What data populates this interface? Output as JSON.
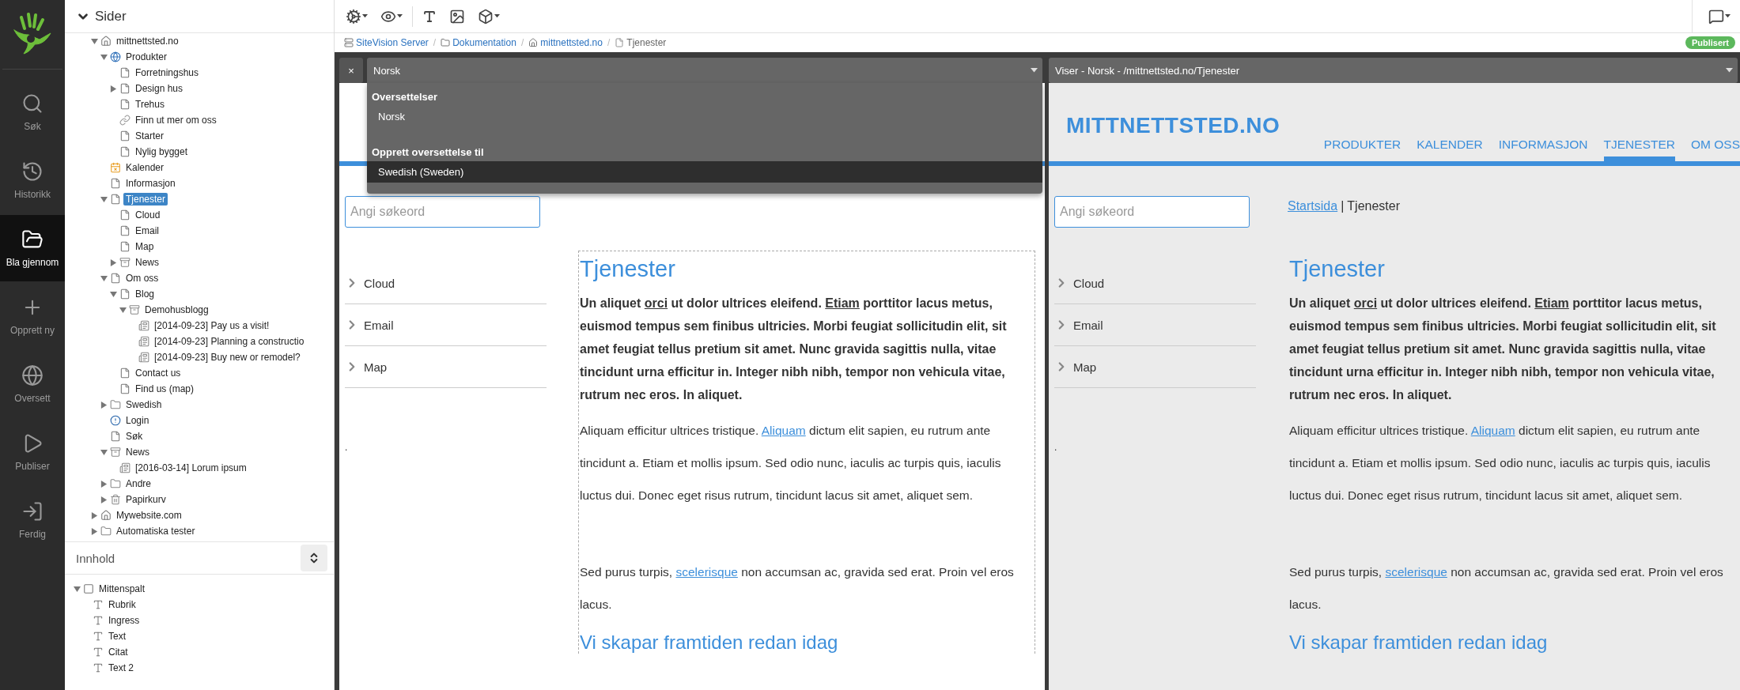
{
  "rail": {
    "items": [
      {
        "kind": "search",
        "label": "Søk",
        "selected": false
      },
      {
        "kind": "history",
        "label": "Historikk",
        "selected": false
      },
      {
        "kind": "browse",
        "label": "Bla gjennom",
        "selected": true
      },
      {
        "kind": "create",
        "label": "Opprett ny",
        "selected": false
      },
      {
        "kind": "translate",
        "label": "Oversett",
        "selected": false
      },
      {
        "kind": "publish",
        "label": "Publiser",
        "selected": false
      },
      {
        "kind": "done",
        "label": "Ferdig",
        "selected": false
      }
    ]
  },
  "pages_panel": {
    "title": "Sider",
    "expanded": true,
    "tree": [
      {
        "kind": "home",
        "label": "mittnettsted.no",
        "expanded": true,
        "selected": false,
        "children": [
          {
            "kind": "globe-page",
            "label": "Produkter",
            "expanded": true,
            "selected": false,
            "children": [
              {
                "kind": "page",
                "label": "Forretningshus",
                "selected": false
              },
              {
                "kind": "page",
                "label": "Design hus",
                "expanded": false,
                "selected": false
              },
              {
                "kind": "page",
                "label": "Trehus",
                "selected": false
              },
              {
                "kind": "link",
                "label": "Finn ut mer om oss",
                "selected": false
              },
              {
                "kind": "page",
                "label": "Starter",
                "selected": false
              },
              {
                "kind": "page",
                "label": "Nylig bygget",
                "selected": false
              }
            ]
          },
          {
            "kind": "calendar",
            "label": "Kalender",
            "selected": false
          },
          {
            "kind": "page",
            "label": "Informasjon",
            "selected": false
          },
          {
            "kind": "page",
            "label": "Tjenester",
            "expanded": true,
            "selected": true,
            "children": [
              {
                "kind": "page",
                "label": "Cloud",
                "selected": false
              },
              {
                "kind": "page",
                "label": "Email",
                "selected": false
              },
              {
                "kind": "page",
                "label": "Map",
                "selected": false
              },
              {
                "kind": "archive",
                "label": "News",
                "expanded": false,
                "selected": false
              }
            ]
          },
          {
            "kind": "page",
            "label": "Om oss",
            "expanded": true,
            "selected": false,
            "children": [
              {
                "kind": "page",
                "label": "Blog",
                "expanded": true,
                "selected": false,
                "children": [
                  {
                    "kind": "archive",
                    "label": "Demohusblogg",
                    "expanded": true,
                    "selected": false,
                    "children": [
                      {
                        "kind": "article",
                        "label": "[2014-09-23] Pay us a visit!",
                        "selected": false
                      },
                      {
                        "kind": "article",
                        "label": "[2014-09-23] Planning a constructio",
                        "selected": false
                      },
                      {
                        "kind": "article",
                        "label": "[2014-09-23] Buy new or remodel?",
                        "selected": false
                      }
                    ]
                  }
                ]
              },
              {
                "kind": "page",
                "label": "Contact us",
                "selected": false
              },
              {
                "kind": "page",
                "label": "Find us (map)",
                "selected": false
              }
            ]
          },
          {
            "kind": "folder",
            "label": "Swedish",
            "expanded": false,
            "selected": false
          },
          {
            "kind": "login",
            "label": "Login",
            "selected": false
          },
          {
            "kind": "page",
            "label": "Søk",
            "selected": false
          },
          {
            "kind": "archive",
            "label": "News",
            "expanded": true,
            "selected": false,
            "children": [
              {
                "kind": "article",
                "label": "[2016-03-14] Lorum ipsum",
                "selected": false
              }
            ]
          },
          {
            "kind": "folder",
            "label": "Andre",
            "expanded": false,
            "selected": false
          },
          {
            "kind": "trash",
            "label": "Papirkurv",
            "expanded": false,
            "selected": false
          }
        ]
      },
      {
        "kind": "home",
        "label": "Mywebsite.com",
        "expanded": false,
        "selected": false
      },
      {
        "kind": "folder",
        "label": "Automatiska tester",
        "expanded": false,
        "selected": false
      }
    ]
  },
  "content_panel": {
    "title": "Innhold",
    "tree": [
      {
        "kind": "region",
        "label": "Mittenspalt",
        "expanded": true,
        "selected": false,
        "children": [
          {
            "kind": "text",
            "label": "Rubrik",
            "selected": false
          },
          {
            "kind": "text",
            "label": "Ingress",
            "selected": false
          },
          {
            "kind": "text",
            "label": "Text",
            "selected": false
          },
          {
            "kind": "text",
            "label": "Citat",
            "selected": false
          },
          {
            "kind": "text",
            "label": "Text 2",
            "selected": false
          }
        ]
      }
    ]
  },
  "toolbar": {
    "tools": [
      {
        "kind": "settings",
        "menu": true
      },
      {
        "kind": "preview",
        "menu": true
      },
      {
        "kind": "font",
        "menu": false
      },
      {
        "kind": "image",
        "menu": false
      },
      {
        "kind": "module",
        "menu": true
      }
    ],
    "right_tools": [
      {
        "kind": "comment",
        "menu": true
      }
    ]
  },
  "breadcrumb": {
    "separator": "/",
    "items": [
      {
        "kind": "server",
        "label": "SiteVision Server",
        "current": false
      },
      {
        "kind": "folder",
        "label": "Dokumentation",
        "current": false
      },
      {
        "kind": "home",
        "label": "mittnettsted.no",
        "current": false
      },
      {
        "kind": "page",
        "label": "Tjenester",
        "current": true
      }
    ]
  },
  "status_badge": "Publisert",
  "left_pane": {
    "close_label": "×",
    "select": {
      "value": "Norsk",
      "open": true,
      "groups": [
        {
          "label": "Oversettelser",
          "options": [
            {
              "label": "Norsk",
              "selected": false
            }
          ]
        },
        {
          "label": "Opprett oversettelse til",
          "options": [
            {
              "label": "Swedish (Sweden)",
              "selected": true
            }
          ]
        }
      ]
    },
    "preview": {
      "edit_mode": true,
      "search_placeholder": "Angi søkeord",
      "subnav": [
        "Cloud",
        "Email",
        "Map"
      ],
      "sidebar_mark": ".",
      "article": {
        "heading": "Tjenester",
        "ingress": [
          {
            "text": "Un aliquet ",
            "link": false
          },
          {
            "text": "orci",
            "link": true
          },
          {
            "text": " ut dolor ultrices eleifend. ",
            "link": false
          },
          {
            "text": "Etiam",
            "link": true
          },
          {
            "text": " porttitor lacus metus, euismod tempus sem finibus ultricies. Morbi feugiat sollicitudin elit, sit amet feugiat tellus pretium sit amet. Nunc gravida sagittis nulla, vitae tincidunt urna efficitur in. Integer nibh nibh, tempor non vehicula vitae, rutrum nec eros. In aliquet.",
            "link": false
          }
        ],
        "paragraphs": [
          [
            {
              "text": "Aliquam efficitur ultrices tristique. ",
              "link": false
            },
            {
              "text": "Aliquam",
              "link": true
            },
            {
              "text": " dictum elit sapien, eu rutrum ante tincidunt a. Etiam et mollis ipsum. Sed odio nunc, iaculis ac turpis quis, iaculis luctus dui. Donec eget risus rutrum, tincidunt lacus sit amet, aliquet sem.",
              "link": false
            }
          ],
          [
            {
              "text": "Sed purus turpis, ",
              "link": false
            },
            {
              "text": "scelerisque",
              "link": true
            },
            {
              "text": " non accumsan ac, gravida sed erat. Proin vel eros lacus.",
              "link": false
            }
          ]
        ],
        "subheading": "Vi skapar framtiden redan idag"
      }
    }
  },
  "right_pane": {
    "select": {
      "value": "Viser - Norsk - /mittnettsted.no/Tjenester",
      "open": false
    },
    "preview": {
      "edit_mode": false,
      "site": {
        "logo": "MITTNETTSTED.NO",
        "nav": [
          {
            "label": "PRODUKTER",
            "selected": false
          },
          {
            "label": "KALENDER",
            "selected": false
          },
          {
            "label": "INFORMASJON",
            "selected": false
          },
          {
            "label": "TJENESTER",
            "selected": true
          },
          {
            "label": "OM OSS",
            "selected": false
          }
        ]
      },
      "search_placeholder": "Angi søkeord",
      "breadcrumb": {
        "link": "Startsida",
        "separator": "|",
        "current": "Tjenester"
      },
      "subnav": [
        "Cloud",
        "Email",
        "Map"
      ],
      "sidebar_mark": ".",
      "article": {
        "heading": "Tjenester",
        "ingress": [
          {
            "text": "Un aliquet ",
            "link": false
          },
          {
            "text": "orci",
            "link": true
          },
          {
            "text": " ut dolor ultrices eleifend. ",
            "link": false
          },
          {
            "text": "Etiam",
            "link": true
          },
          {
            "text": " porttitor lacus metus, euismod tempus sem finibus ultricies. Morbi feugiat sollicitudin elit, sit amet feugiat tellus pretium sit amet. Nunc gravida sagittis nulla, vitae tincidunt urna efficitur in. Integer nibh nibh, tempor non vehicula vitae, rutrum nec eros. In aliquet.",
            "link": false
          }
        ],
        "paragraphs": [
          [
            {
              "text": "Aliquam efficitur ultrices tristique. ",
              "link": false
            },
            {
              "text": "Aliquam",
              "link": true
            },
            {
              "text": " dictum elit sapien, eu rutrum ante tincidunt a. Etiam et mollis ipsum. Sed odio nunc, iaculis ac turpis quis, iaculis luctus dui. Donec eget risus rutrum, tincidunt lacus sit amet, aliquet sem.",
              "link": false
            }
          ],
          [
            {
              "text": "Sed purus turpis, ",
              "link": false
            },
            {
              "text": "scelerisque",
              "link": true
            },
            {
              "text": " non accumsan ac, gravida sed erat. Proin vel eros lacus.",
              "link": false
            }
          ]
        ],
        "subheading": "Vi skapar framtiden redan idag"
      }
    }
  }
}
